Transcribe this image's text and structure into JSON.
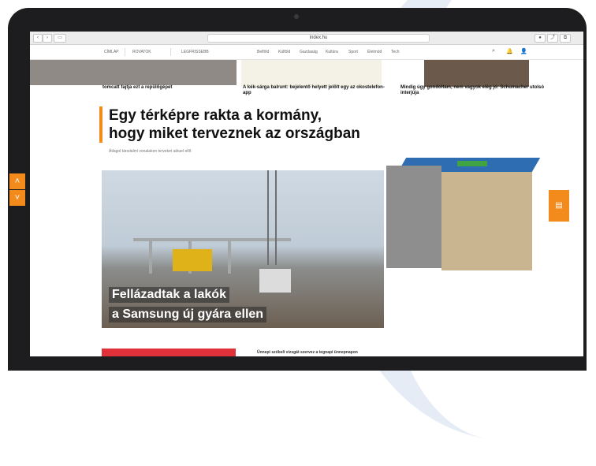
{
  "browser": {
    "url": "index.hu"
  },
  "site_nav": {
    "items": [
      "CÍMLAP",
      "ROVATOK",
      "LEGFRISSEBB",
      "Belföld",
      "Külföld",
      "Gazdaság",
      "Kultúra",
      "Sport",
      "Életmód",
      "Tech"
    ]
  },
  "top_teasers": [
    {
      "caption": "tomcatt fajtja ezt a repülőgépet"
    },
    {
      "caption": "A kék-sárga balrunt: bejelentő helyett jelölt egy az okostelefon-app"
    },
    {
      "caption": "Mindig úgy gondoltam, nem vagyok elég jó: Schumacher utolsó interjúja"
    }
  ],
  "main": {
    "headline_line1": "Egy térképre rakta a kormány,",
    "headline_line2": "hogy miket terveznek az országban",
    "subline": "Átlagol társdalmi vonalakon terveket aktuel előt",
    "photo_caption_line1": "Fellázadtak a lakók",
    "photo_caption_line2": "a Samsung új gyára ellen"
  },
  "bottom": {
    "teaser_text": "Ünnepi szóbeli vizsgát szervez a tegnapi ünnepnapon"
  },
  "colors": {
    "accent": "#f28b1c",
    "red": "#e0313b"
  },
  "icons": {
    "up": "chevron-up-icon",
    "down": "chevron-down-icon",
    "search": "search-icon",
    "bell": "bell-icon",
    "user": "user-icon"
  }
}
